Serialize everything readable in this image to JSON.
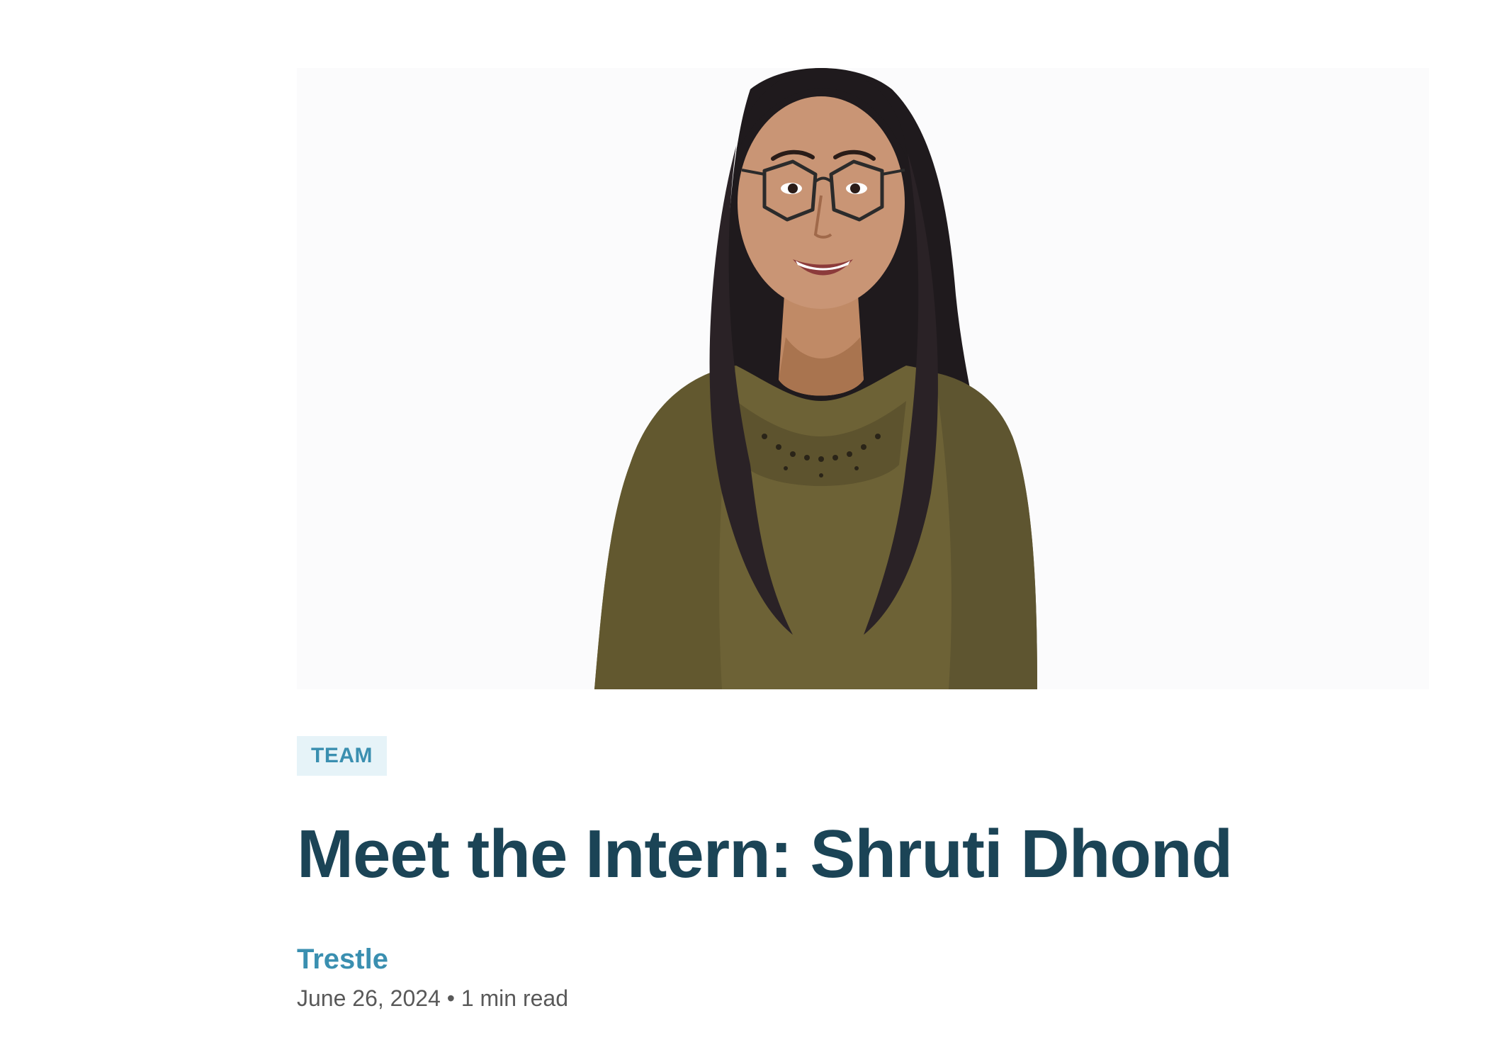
{
  "hero": {
    "image_label": "portrait-photo",
    "background": "#fbfbfc"
  },
  "post": {
    "category": "TEAM",
    "title": "Meet the Intern: Shruti Dhond",
    "author": "Trestle",
    "date": "June 26, 2024",
    "separator": "•",
    "read_time": "1 min read"
  },
  "colors": {
    "title": "#1b4456",
    "accent": "#3a8fb0",
    "tag_bg": "#e6f3f8",
    "meta": "#595959"
  }
}
